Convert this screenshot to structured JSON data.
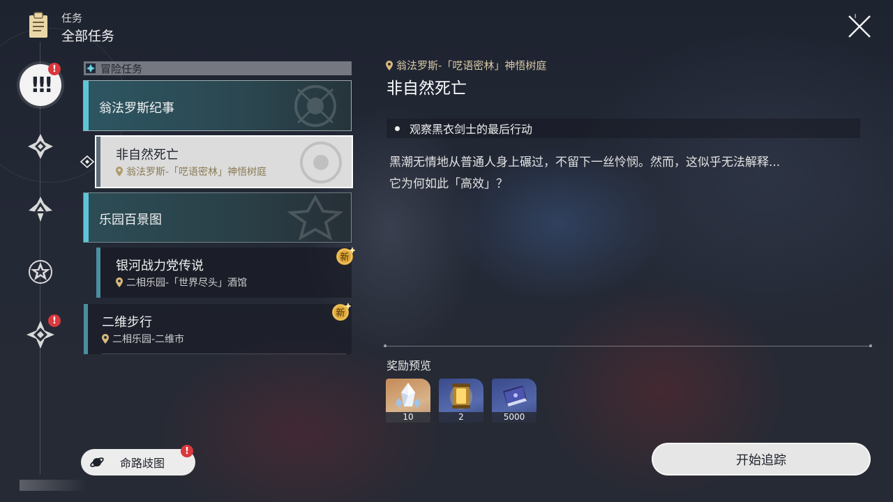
{
  "header": {
    "subtitle": "任务",
    "title": "全部任务"
  },
  "section": {
    "label": "冒险任务"
  },
  "quest_list": [
    {
      "kind": "group",
      "title": "翁法罗斯纪事"
    },
    {
      "kind": "item",
      "title": "非自然死亡",
      "location": "翁法罗斯-「呓语密林」神悟树庭",
      "selected": true
    },
    {
      "kind": "group",
      "title": "乐园百景图"
    },
    {
      "kind": "item",
      "title": "银河战力党传说",
      "location": "二相乐园-「世界尽头」酒馆",
      "badge": "新"
    },
    {
      "kind": "item",
      "title": "二维步行",
      "location": "二相乐园-二维市",
      "badge": "新"
    }
  ],
  "detail": {
    "location": "翁法罗斯-「呓语密林」神悟树庭",
    "title": "非自然死亡",
    "objective": "观察黑衣剑士的最后行动",
    "description_lines": [
      "黑潮无情地从普通人身上碾过，不留下一丝怜悯。然而，这似乎无法解释...",
      "它为何如此「高效」？"
    ]
  },
  "rewards": {
    "header": "奖励预览",
    "items": [
      {
        "icon": "crystal-icon",
        "count": "10"
      },
      {
        "icon": "lantern-icon",
        "count": "2"
      },
      {
        "icon": "book-icon",
        "count": "5000"
      }
    ]
  },
  "buttons": {
    "track": "开始追踪",
    "path_map": "命路歧图"
  },
  "badges": {
    "alert": "!"
  },
  "colors": {
    "accent_cyan": "#5fc4d8",
    "location_gold": "#d8c9a6",
    "badge_red": "#d9383c",
    "new_badge_gold": "#e0a93a"
  }
}
